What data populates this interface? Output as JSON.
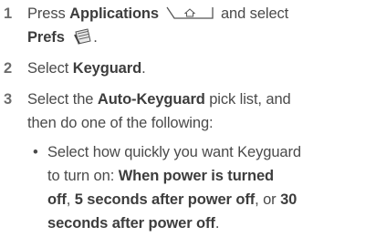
{
  "steps": [
    {
      "number": "1",
      "line1_pre": "Press ",
      "line1_bold": "Applications",
      "line1_post": " and select",
      "line2_bold": "Prefs",
      "line2_post": "."
    },
    {
      "number": "2",
      "pre": "Select ",
      "bold": "Keyguard",
      "post": "."
    },
    {
      "number": "3",
      "line1_pre": "Select the ",
      "line1_bold": "Auto-Keyguard",
      "line1_post": " pick list, and",
      "line2": "then do one of the following:"
    }
  ],
  "bullet": {
    "symbol": "•",
    "line1": "Select how quickly you want Keyguard",
    "line2_pre": "to turn on: ",
    "line2_bold": "When power is turned",
    "line3_bold_a": "off",
    "line3_sep1": ", ",
    "line3_bold_b": "5 seconds after power off",
    "line3_sep2": ", or ",
    "line3_bold_c": "30",
    "line4_bold": "seconds after power off",
    "line4_post": "."
  },
  "icons": {
    "applications_key": "home-key-icon",
    "prefs": "prefs-app-icon"
  }
}
